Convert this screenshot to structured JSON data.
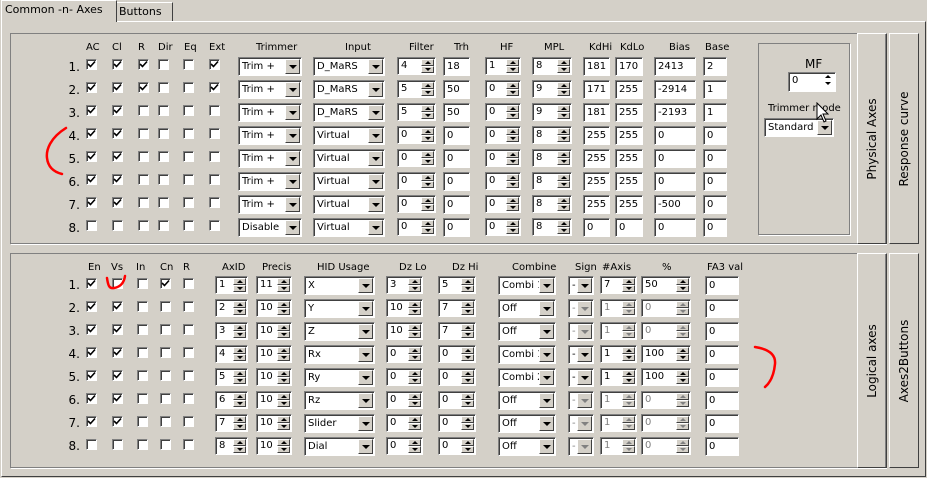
{
  "tabs": [
    "Common -n- Axes",
    "Buttons"
  ],
  "physical": {
    "side_tabs": [
      "Physical Axes",
      "Response curve"
    ],
    "headers": {
      "ac": "AC",
      "cl": "Cl",
      "r": "R",
      "dir": "Dir",
      "eq": "Eq",
      "ext": "Ext",
      "trimmer": "Trimmer",
      "input": "Input",
      "filter": "Filter",
      "trh": "Trh",
      "hf": "HF",
      "mpl": "MPL",
      "kdhi": "KdHi",
      "kdlo": "KdLo",
      "bias": "Bias",
      "base": "Base"
    },
    "rows": [
      {
        "num": "1.",
        "ac": true,
        "cl": true,
        "r": true,
        "dir": false,
        "eq": false,
        "ext": true,
        "trimmer": "Trim +",
        "input": "D_MaRS",
        "filter": "4",
        "trh": "18",
        "hf": "1",
        "mpl": "8",
        "kdhi": "181",
        "kdlo": "170",
        "bias": "2413",
        "base": "2"
      },
      {
        "num": "2.",
        "ac": true,
        "cl": true,
        "r": true,
        "dir": false,
        "eq": false,
        "ext": true,
        "trimmer": "Trim +",
        "input": "D_MaRS",
        "filter": "5",
        "trh": "50",
        "hf": "0",
        "mpl": "9",
        "kdhi": "171",
        "kdlo": "255",
        "bias": "-2914",
        "base": "1"
      },
      {
        "num": "3.",
        "ac": true,
        "cl": true,
        "r": false,
        "dir": false,
        "eq": false,
        "ext": false,
        "trimmer": "Trim +",
        "input": "D_MaRS",
        "filter": "5",
        "trh": "50",
        "hf": "0",
        "mpl": "9",
        "kdhi": "181",
        "kdlo": "255",
        "bias": "-2193",
        "base": "1"
      },
      {
        "num": "4.",
        "ac": true,
        "cl": true,
        "r": false,
        "dir": false,
        "eq": false,
        "ext": false,
        "trimmer": "Trim +",
        "input": "Virtual",
        "filter": "0",
        "trh": "0",
        "hf": "0",
        "mpl": "8",
        "kdhi": "255",
        "kdlo": "255",
        "bias": "0",
        "base": "0"
      },
      {
        "num": "5.",
        "ac": true,
        "cl": true,
        "r": false,
        "dir": false,
        "eq": false,
        "ext": false,
        "trimmer": "Trim +",
        "input": "Virtual",
        "filter": "0",
        "trh": "0",
        "hf": "0",
        "mpl": "8",
        "kdhi": "255",
        "kdlo": "255",
        "bias": "0",
        "base": "0"
      },
      {
        "num": "6.",
        "ac": true,
        "cl": true,
        "r": false,
        "dir": false,
        "eq": false,
        "ext": false,
        "trimmer": "Trim +",
        "input": "Virtual",
        "filter": "0",
        "trh": "0",
        "hf": "0",
        "mpl": "8",
        "kdhi": "255",
        "kdlo": "255",
        "bias": "0",
        "base": "0"
      },
      {
        "num": "7.",
        "ac": true,
        "cl": true,
        "r": false,
        "dir": false,
        "eq": false,
        "ext": false,
        "trimmer": "Trim +",
        "input": "Virtual",
        "filter": "0",
        "trh": "0",
        "hf": "0",
        "mpl": "8",
        "kdhi": "255",
        "kdlo": "255",
        "bias": "-500",
        "base": "0"
      },
      {
        "num": "8.",
        "ac": false,
        "cl": false,
        "r": false,
        "dir": false,
        "eq": false,
        "ext": false,
        "trimmer": "Disable",
        "input": "Virtual",
        "filter": "0",
        "trh": "0",
        "hf": "0",
        "mpl": "8",
        "kdhi": "0",
        "kdlo": "0",
        "bias": "0",
        "base": "0"
      }
    ]
  },
  "mf": {
    "label": "MF",
    "value": "0",
    "trimmer_mode_label": "Trimmer mode",
    "trimmer_mode_value": "Standard"
  },
  "logical": {
    "side_tabs": [
      "Logical axes",
      "Axes2Buttons"
    ],
    "headers": {
      "en": "En",
      "vs": "Vs",
      "in": "In",
      "cn": "Cn",
      "r": "R",
      "axid": "AxID",
      "precis": "Precis",
      "hid": "HID Usage",
      "dzlo": "Dz Lo",
      "dzhi": "Dz Hi",
      "combine": "Combine",
      "sign": "Sign",
      "naxis": "#Axis",
      "pct": "%",
      "fa3": "FA3 val"
    },
    "rows": [
      {
        "num": "1.",
        "en": true,
        "vs": false,
        "in": false,
        "cn": true,
        "r": false,
        "axid": "1",
        "precis": "11",
        "hid": "X",
        "dzlo": "3",
        "dzhi": "5",
        "combine": "Combi 1",
        "sign": "-",
        "naxis": "7",
        "pct": "50",
        "fa3": "0",
        "combo_on": true
      },
      {
        "num": "2.",
        "en": true,
        "vs": true,
        "in": false,
        "cn": false,
        "r": false,
        "axid": "2",
        "precis": "10",
        "hid": "Y",
        "dzlo": "10",
        "dzhi": "7",
        "combine": "Off",
        "sign": "-",
        "naxis": "1",
        "pct": "0",
        "fa3": "0",
        "combo_on": false
      },
      {
        "num": "3.",
        "en": true,
        "vs": true,
        "in": false,
        "cn": false,
        "r": false,
        "axid": "3",
        "precis": "10",
        "hid": "Z",
        "dzlo": "10",
        "dzhi": "7",
        "combine": "Off",
        "sign": "-",
        "naxis": "1",
        "pct": "0",
        "fa3": "0",
        "combo_on": false
      },
      {
        "num": "4.",
        "en": true,
        "vs": true,
        "in": false,
        "cn": false,
        "r": false,
        "axid": "4",
        "precis": "10",
        "hid": "Rx",
        "dzlo": "0",
        "dzhi": "0",
        "combine": "Combi 1",
        "sign": "-",
        "naxis": "1",
        "pct": "100",
        "fa3": "0",
        "combo_on": true
      },
      {
        "num": "5.",
        "en": true,
        "vs": true,
        "in": false,
        "cn": false,
        "r": false,
        "axid": "5",
        "precis": "10",
        "hid": "Ry",
        "dzlo": "0",
        "dzhi": "0",
        "combine": "Combi 2",
        "sign": "-",
        "naxis": "1",
        "pct": "100",
        "fa3": "0",
        "combo_on": true
      },
      {
        "num": "6.",
        "en": true,
        "vs": true,
        "in": false,
        "cn": false,
        "r": false,
        "axid": "6",
        "precis": "10",
        "hid": "Rz",
        "dzlo": "0",
        "dzhi": "0",
        "combine": "Off",
        "sign": "-",
        "naxis": "1",
        "pct": "0",
        "fa3": "0",
        "combo_on": false
      },
      {
        "num": "7.",
        "en": true,
        "vs": true,
        "in": false,
        "cn": false,
        "r": false,
        "axid": "7",
        "precis": "10",
        "hid": "Slider",
        "dzlo": "0",
        "dzhi": "0",
        "combine": "Off",
        "sign": "-",
        "naxis": "1",
        "pct": "0",
        "fa3": "0",
        "combo_on": false
      },
      {
        "num": "8.",
        "en": false,
        "vs": false,
        "in": false,
        "cn": false,
        "r": false,
        "axid": "8",
        "precis": "10",
        "hid": "Dial",
        "dzlo": "0",
        "dzhi": "0",
        "combine": "Off",
        "sign": "-",
        "naxis": "1",
        "pct": "0",
        "fa3": "0",
        "combo_on": false
      }
    ]
  },
  "annotation_color": "#ff0000"
}
